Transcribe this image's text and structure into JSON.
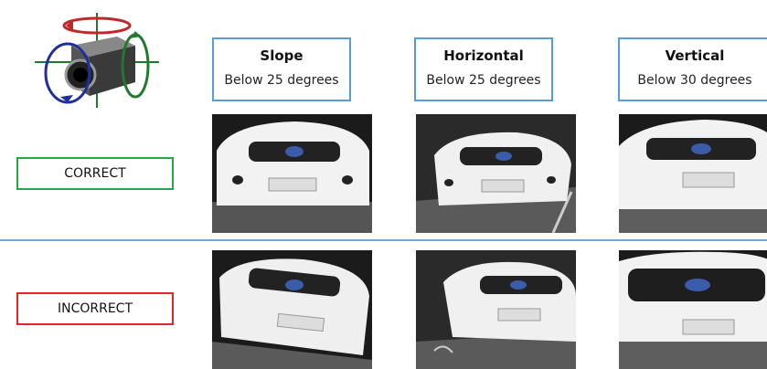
{
  "columns": [
    {
      "title": "Slope",
      "subtitle": "Below 25 degrees"
    },
    {
      "title": "Horizontal",
      "subtitle": "Below 25 degrees"
    },
    {
      "title": "Vertical",
      "subtitle": "Below 30 degrees"
    }
  ],
  "rows": [
    {
      "label": "CORRECT",
      "color": "#22a845"
    },
    {
      "label": "INCORRECT",
      "color": "#e0262b"
    }
  ],
  "colors": {
    "header_border": "#5b9bd5",
    "divider": "#6fa8dc",
    "axis_red": "#c0282c",
    "axis_blue": "#1f2f9c",
    "axis_green": "#1f7a2c"
  },
  "icons": [
    "camera-rotation-axes-icon"
  ]
}
